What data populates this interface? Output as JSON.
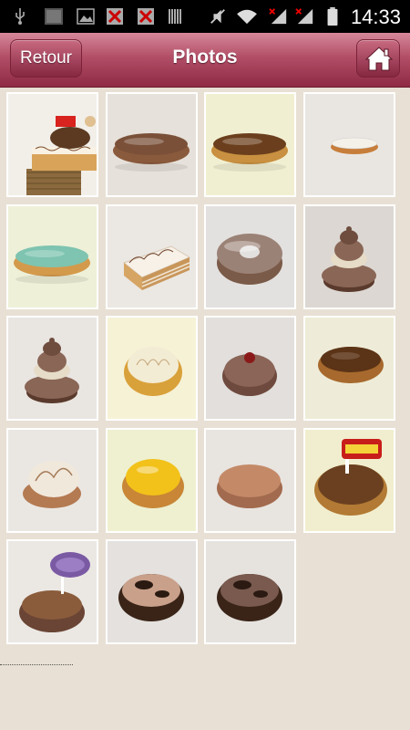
{
  "status_bar": {
    "time": "14:33",
    "icons": [
      "usb-icon",
      "image-icon",
      "gallery-icon",
      "notification-icon",
      "notification-icon",
      "barcode-icon",
      "mute-icon",
      "wifi-icon",
      "signal-icon",
      "signal-icon",
      "battery-icon"
    ]
  },
  "header": {
    "back_label": "Retour",
    "title": "Photos",
    "home_icon": "home-icon"
  },
  "photos": [
    {
      "subject": "pastry-assortment",
      "bg": "#f2efe9",
      "kind": "assort"
    },
    {
      "subject": "chocolate-eclair",
      "bg": "#e6e1da",
      "kind": "eclair",
      "top": "#7a5038",
      "base": "#8a5a3c"
    },
    {
      "subject": "coffee-eclair",
      "bg": "#f1efd2",
      "kind": "eclair",
      "top": "#6b3f1d",
      "base": "#c89040"
    },
    {
      "subject": "vanilla-eclair",
      "bg": "#e9e6e2",
      "kind": "eclair-small",
      "top": "#f4f1e8",
      "base": "#c77e3a"
    },
    {
      "subject": "pistachio-eclair",
      "bg": "#eef0d8",
      "kind": "eclair",
      "top": "#7ec4b0",
      "base": "#d49a4c"
    },
    {
      "subject": "mille-feuille",
      "bg": "#ebe7e2",
      "kind": "millefeuille"
    },
    {
      "subject": "paris-brest",
      "bg": "#e3e1df",
      "kind": "ring"
    },
    {
      "subject": "religieuse-chocolate",
      "bg": "#dcd7d2",
      "kind": "religieuse"
    },
    {
      "subject": "religieuse-chocolate",
      "bg": "#e9e5e1",
      "kind": "religieuse"
    },
    {
      "subject": "meringue-tart",
      "bg": "#f6f2d6",
      "kind": "tart-meringue"
    },
    {
      "subject": "cherry-chocolate-tart",
      "bg": "#e2dfdc",
      "kind": "tart-cherry"
    },
    {
      "subject": "chocolate-tart",
      "bg": "#eeecd8",
      "kind": "tart-choco"
    },
    {
      "subject": "lemon-meringue-tart",
      "bg": "#eae7e3",
      "kind": "tart-meringue2"
    },
    {
      "subject": "lemon-tart",
      "bg": "#eef0d0",
      "kind": "tart-lemon"
    },
    {
      "subject": "almond-tart",
      "bg": "#e8e4e0",
      "kind": "tart-almond"
    },
    {
      "subject": "chocolate-tart-with-sign",
      "bg": "#f1eecf",
      "kind": "tart-sign"
    },
    {
      "subject": "milka-tart",
      "bg": "#ebe8e4",
      "kind": "tart-milka"
    },
    {
      "subject": "chocolate-tart-dark",
      "bg": "#e4e1de",
      "kind": "tart-dark"
    },
    {
      "subject": "chocolate-tart-caramel",
      "bg": "#e6e3df",
      "kind": "tart-dark2"
    }
  ]
}
